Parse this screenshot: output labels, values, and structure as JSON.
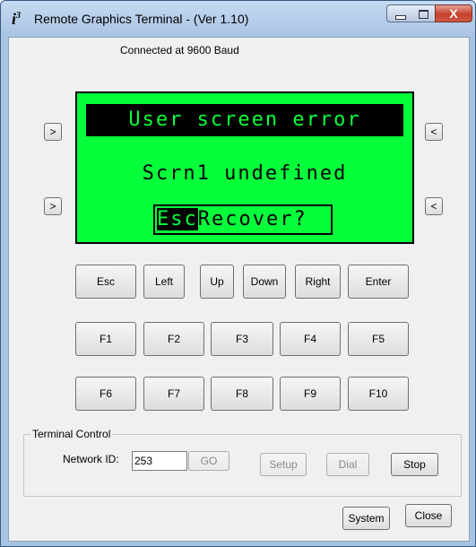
{
  "window": {
    "icon": "i3-icon",
    "title": "Remote Graphics Terminal - (Ver 1.10)",
    "controls": {
      "minimize": "minimize-icon",
      "maximize": "maximize-icon",
      "close": "X"
    }
  },
  "status": "Connected at 9600 Baud",
  "lcd": {
    "line1": "User screen error",
    "line2": "Scrn1 undefined",
    "line3_esc": "Esc",
    "line3_rest": "Recover?",
    "color": "#06ff3b"
  },
  "side_buttons": {
    "left_top": ">",
    "left_bottom": ">",
    "right_top": "<",
    "right_bottom": "<"
  },
  "nav_keys": [
    "Esc",
    "Left",
    "Up",
    "Down",
    "Right",
    "Enter"
  ],
  "fkeys_row1": [
    "F1",
    "F2",
    "F3",
    "F4",
    "F5"
  ],
  "fkeys_row2": [
    "F6",
    "F7",
    "F8",
    "F9",
    "F10"
  ],
  "terminal_control": {
    "label": "Terminal Control",
    "network_id_label": "Network ID:",
    "network_id_value": "253",
    "go": "GO",
    "setup": "Setup",
    "dial": "Dial",
    "stop": "Stop"
  },
  "bottom": {
    "system": "System",
    "close": "Close"
  }
}
